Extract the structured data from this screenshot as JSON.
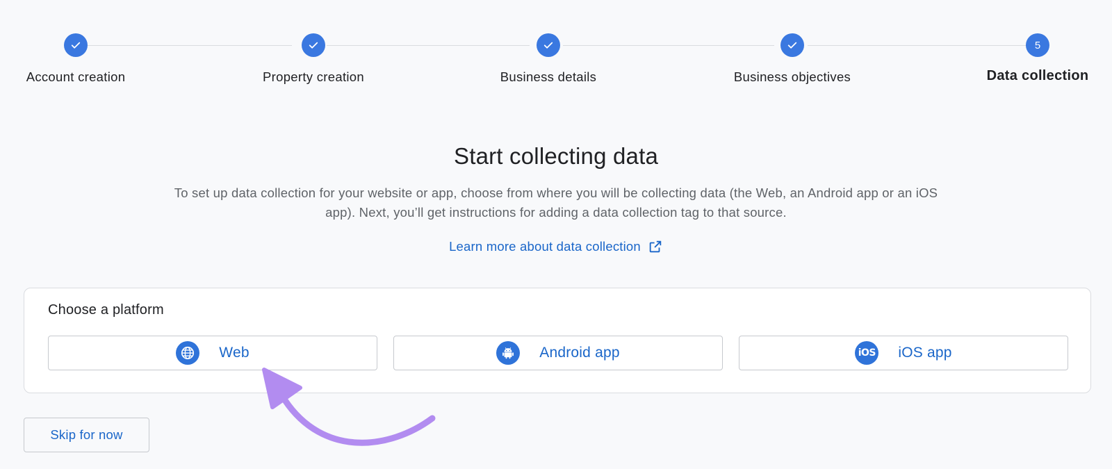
{
  "stepper": {
    "steps": [
      {
        "label": "Account creation",
        "state": "completed",
        "indicator_icon": "check-icon"
      },
      {
        "label": "Property creation",
        "state": "completed",
        "indicator_icon": "check-icon"
      },
      {
        "label": "Business details",
        "state": "completed",
        "indicator_icon": "check-icon"
      },
      {
        "label": "Business objectives",
        "state": "completed",
        "indicator_icon": "check-icon"
      },
      {
        "label": "Data collection",
        "state": "current",
        "number": "5"
      }
    ]
  },
  "main": {
    "title": "Start collecting data",
    "description": "To set up data collection for your website or app, choose from where you will be collecting data (the Web, an Android app or an iOS app). Next, you’ll get instructions for adding a data collection tag to that source.",
    "learn_more_link": "Learn more about data collection",
    "learn_more_icon": "external-link-icon"
  },
  "platform_card": {
    "heading": "Choose a platform",
    "options": [
      {
        "label": "Web",
        "icon": "globe-icon"
      },
      {
        "label": "Android app",
        "icon": "android-icon"
      },
      {
        "label": "iOS app",
        "icon": "ios-icon",
        "icon_text": "iOS"
      }
    ]
  },
  "footer": {
    "skip_label": "Skip for now"
  },
  "annotation": {
    "arrow_icon": "curved-arrow-icon",
    "color": "#b28cf0"
  },
  "colors": {
    "accent": "#3a78e0",
    "link": "#1a66c9",
    "background": "#f8f9fb",
    "border": "#dadce0"
  }
}
